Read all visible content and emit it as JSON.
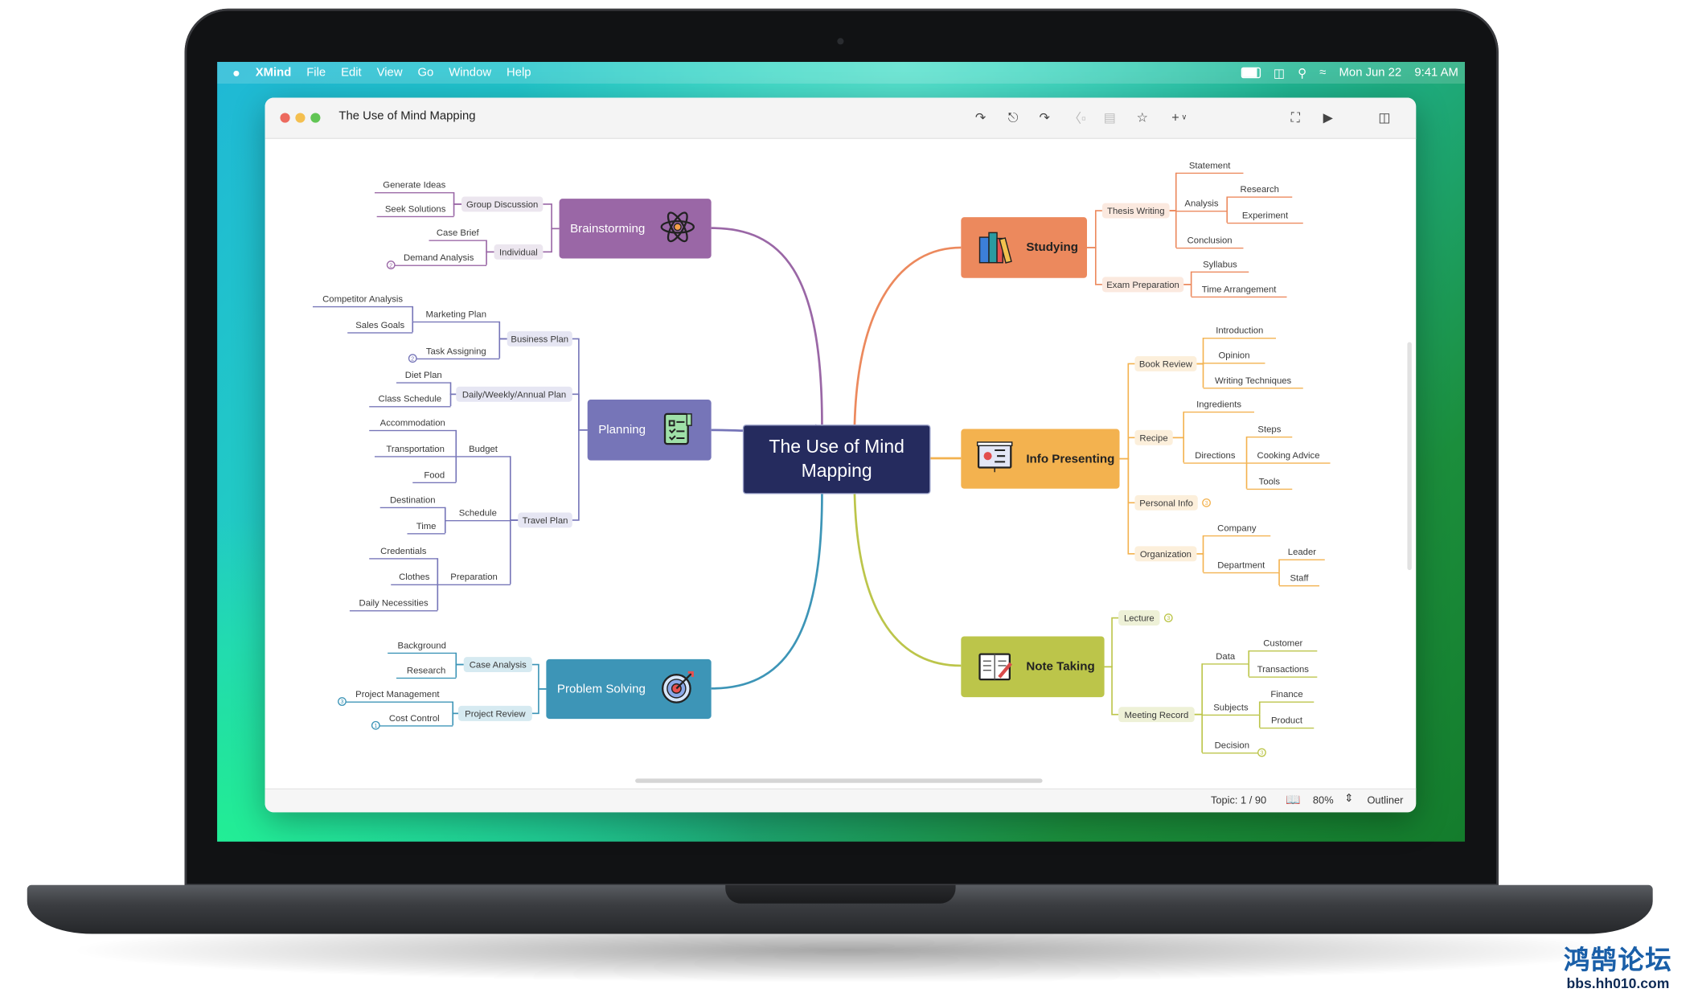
{
  "menubar": {
    "app_name": "XMind",
    "items": [
      "File",
      "Edit",
      "View",
      "Go",
      "Window",
      "Help"
    ],
    "date": "Mon Jun 22",
    "time": "9:41 AM"
  },
  "window": {
    "title": "The Use of Mind Mapping",
    "toolbar_icons": [
      "insert-topic-icon",
      "insert-subtopic-icon",
      "relationship-icon",
      "boundary-icon",
      "summary-icon",
      "star-icon",
      "plus-icon",
      "fullscreen-icon",
      "play-icon",
      "sidebar-icon"
    ]
  },
  "statusbar": {
    "topic": "Topic: 1 / 90",
    "zoom": "80%",
    "outliner": "Outliner"
  },
  "mindmap": {
    "central_topic": "The Use of Mind Mapping",
    "central_color": "#252b5e",
    "branches": [
      {
        "label": "Brainstorming",
        "color": "#9a67a6",
        "tint": "#ece6ef",
        "icon": "atom-icon",
        "subtopics": [
          {
            "label": "Group Discussion",
            "children": [
              {
                "label": "Generate Ideas"
              },
              {
                "label": "Seek Solutions"
              }
            ]
          },
          {
            "label": "Individual",
            "children": [
              {
                "label": "Case Brief"
              },
              {
                "label": "Demand Analysis",
                "collapsed_count": "2"
              }
            ]
          }
        ]
      },
      {
        "label": "Planning",
        "color": "#7675b8",
        "tint": "#e6e6f3",
        "icon": "checklist-icon",
        "subtopics": [
          {
            "label": "Business Plan",
            "children": [
              {
                "label": "Marketing Plan",
                "children": [
                  {
                    "label": "Competitor Analysis"
                  },
                  {
                    "label": "Sales Goals"
                  }
                ]
              },
              {
                "label": "Task Assigning",
                "collapsed_count": "2"
              }
            ]
          },
          {
            "label": "Daily/Weekly/Annual Plan",
            "children": [
              {
                "label": "Diet Plan"
              },
              {
                "label": "Class Schedule"
              }
            ]
          },
          {
            "label": "Travel Plan",
            "children": [
              {
                "label": "Budget",
                "children": [
                  {
                    "label": "Accommodation"
                  },
                  {
                    "label": "Transportation"
                  },
                  {
                    "label": "Food"
                  }
                ]
              },
              {
                "label": "Schedule",
                "children": [
                  {
                    "label": "Destination"
                  },
                  {
                    "label": "Time"
                  }
                ]
              },
              {
                "label": "Preparation",
                "children": [
                  {
                    "label": "Credentials"
                  },
                  {
                    "label": "Clothes"
                  },
                  {
                    "label": "Daily Necessities"
                  }
                ]
              }
            ]
          }
        ]
      },
      {
        "label": "Problem Solving",
        "color": "#3d95b7",
        "tint": "#d6eaf1",
        "icon": "target-icon",
        "subtopics": [
          {
            "label": "Case Analysis",
            "children": [
              {
                "label": "Background"
              },
              {
                "label": "Research"
              }
            ]
          },
          {
            "label": "Project Review",
            "children": [
              {
                "label": "Project Management",
                "collapsed_count": "3"
              },
              {
                "label": "Cost Control",
                "collapsed_count": "1"
              }
            ]
          }
        ]
      },
      {
        "label": "Studying",
        "color": "#ec895d",
        "tint": "#fbe9df",
        "icon": "books-icon",
        "subtopics": [
          {
            "label": "Thesis Writing",
            "children": [
              {
                "label": "Statement"
              },
              {
                "label": "Analysis",
                "children": [
                  {
                    "label": "Research"
                  },
                  {
                    "label": "Experiment"
                  }
                ]
              },
              {
                "label": "Conclusion"
              }
            ]
          },
          {
            "label": "Exam Preparation",
            "children": [
              {
                "label": "Syllabus"
              },
              {
                "label": "Time Arrangement"
              }
            ]
          }
        ]
      },
      {
        "label": "Info Presenting",
        "color": "#f3b24f",
        "tint": "#fcefdb",
        "icon": "presentation-board-icon",
        "subtopics": [
          {
            "label": "Book Review",
            "children": [
              {
                "label": "Introduction"
              },
              {
                "label": "Opinion"
              },
              {
                "label": "Writing Techniques"
              }
            ]
          },
          {
            "label": "Recipe",
            "children": [
              {
                "label": "Ingredients"
              },
              {
                "label": "Directions",
                "children": [
                  {
                    "label": "Steps"
                  },
                  {
                    "label": "Cooking Advice"
                  },
                  {
                    "label": "Tools"
                  }
                ]
              }
            ]
          },
          {
            "label": "Personal Info",
            "collapsed_count": "3"
          },
          {
            "label": "Organization",
            "children": [
              {
                "label": "Company"
              },
              {
                "label": "Department",
                "children": [
                  {
                    "label": "Leader"
                  },
                  {
                    "label": "Staff"
                  }
                ]
              }
            ]
          }
        ]
      },
      {
        "label": "Note Taking",
        "color": "#bcc54a",
        "tint": "#eef1d7",
        "icon": "notebook-icon",
        "subtopics": [
          {
            "label": "Lecture",
            "collapsed_count": "3"
          },
          {
            "label": "Meeting Record",
            "children": [
              {
                "label": "Data",
                "children": [
                  {
                    "label": "Customer"
                  },
                  {
                    "label": "Transactions"
                  }
                ]
              },
              {
                "label": "Subjects",
                "children": [
                  {
                    "label": "Finance"
                  },
                  {
                    "label": "Product"
                  }
                ]
              },
              {
                "label": "Decision",
                "collapsed_count": "3"
              }
            ]
          }
        ]
      }
    ]
  },
  "watermark": {
    "line1": "鸿鹄论坛",
    "line2": "bbs.hh010.com"
  }
}
